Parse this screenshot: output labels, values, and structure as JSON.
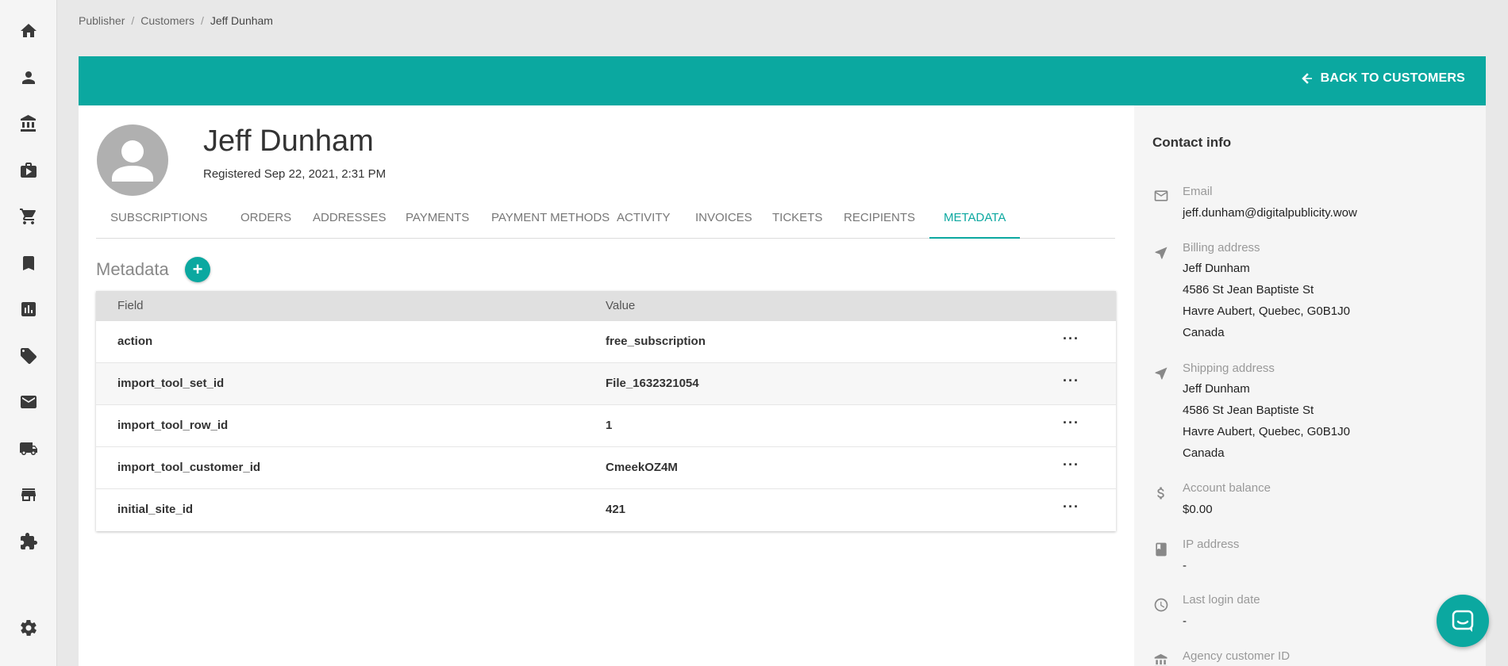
{
  "breadcrumb": {
    "items": [
      "Publisher",
      "Customers",
      "Jeff Dunham"
    ],
    "separator": "/"
  },
  "header": {
    "back_label": "BACK TO CUSTOMERS",
    "accent_color": "#0ba8a0"
  },
  "sidebar": {
    "items": [
      {
        "icon": "home-icon"
      },
      {
        "icon": "person-icon"
      },
      {
        "icon": "bank-icon"
      },
      {
        "icon": "media-briefcase-icon"
      },
      {
        "icon": "cart-icon"
      },
      {
        "icon": "bookmark-icon"
      },
      {
        "icon": "bar-chart-icon"
      },
      {
        "icon": "ticket-icon"
      },
      {
        "icon": "mail-icon"
      },
      {
        "icon": "truck-icon"
      },
      {
        "icon": "store-icon"
      },
      {
        "icon": "puzzle-icon"
      },
      {
        "icon": "gear-icon"
      }
    ]
  },
  "customer": {
    "name": "Jeff Dunham",
    "registered": "Registered Sep 22, 2021, 2:31 PM"
  },
  "tabs": [
    {
      "label": "SUBSCRIPTIONS"
    },
    {
      "label": "ORDERS"
    },
    {
      "label": "ADDRESSES"
    },
    {
      "label": "PAYMENTS"
    },
    {
      "label": "PAYMENT METHODS"
    },
    {
      "label": "ACTIVITY"
    },
    {
      "label": "INVOICES"
    },
    {
      "label": "TICKETS"
    },
    {
      "label": "RECIPIENTS"
    },
    {
      "label": "METADATA",
      "active": true
    }
  ],
  "metadata": {
    "title": "Metadata",
    "add_label": "+",
    "columns": [
      "Field",
      "Value"
    ],
    "more_label": "···",
    "rows": [
      {
        "field": "action",
        "value": "free_subscription"
      },
      {
        "field": "import_tool_set_id",
        "value": "File_1632321054"
      },
      {
        "field": "import_tool_row_id",
        "value": "1"
      },
      {
        "field": "import_tool_customer_id",
        "value": "CmeekOZ4M"
      },
      {
        "field": "initial_site_id",
        "value": "421"
      }
    ]
  },
  "contact": {
    "title": "Contact info",
    "email_label": "Email",
    "email": "jeff.dunham@digitalpublicity.wow",
    "billing_label": "Billing address",
    "billing": [
      "Jeff Dunham",
      "4586 St Jean Baptiste St",
      "Havre Aubert, Quebec, G0B1J0",
      "Canada"
    ],
    "shipping_label": "Shipping address",
    "shipping": [
      "Jeff Dunham",
      "4586 St Jean Baptiste St",
      "Havre Aubert, Quebec, G0B1J0",
      "Canada"
    ],
    "balance_label": "Account balance",
    "balance": "$0.00",
    "ip_label": "IP address",
    "ip": "-",
    "login_label": "Last login date",
    "login": "-",
    "agency_label": "Agency customer ID"
  }
}
